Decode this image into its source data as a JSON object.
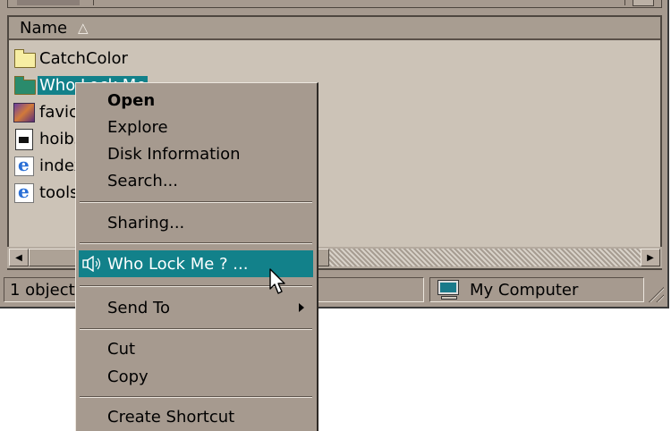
{
  "list": {
    "column_name": "Name",
    "items": [
      {
        "label": "CatchColor",
        "icon": "folder-icon"
      },
      {
        "label": "Who Lock Me",
        "icon": "folder-icon"
      },
      {
        "label": "favicon",
        "icon": "image-icon"
      },
      {
        "label": "hoibs",
        "icon": "document-icon"
      },
      {
        "label": "index",
        "icon": "ie-document-icon"
      },
      {
        "label": "tools",
        "icon": "ie-document-icon"
      }
    ]
  },
  "context_menu": {
    "items": [
      {
        "label": "Open",
        "bold": true
      },
      {
        "label": "Explore"
      },
      {
        "label": "Disk Information"
      },
      {
        "label": "Search..."
      },
      {
        "label": "Sharing..."
      },
      {
        "label": "Who Lock Me ? ...",
        "highlighted": true,
        "icon": "speaker-icon"
      },
      {
        "label": "Send To",
        "submenu": true
      },
      {
        "label": "Cut"
      },
      {
        "label": "Copy"
      },
      {
        "label": "Create Shortcut"
      }
    ]
  },
  "status": {
    "objects": "1 object(s) selected",
    "location": "My Computer"
  },
  "colors": {
    "window_bg": "#a69a8f",
    "list_bg": "#ccc3b7",
    "highlight": "#12818a"
  }
}
